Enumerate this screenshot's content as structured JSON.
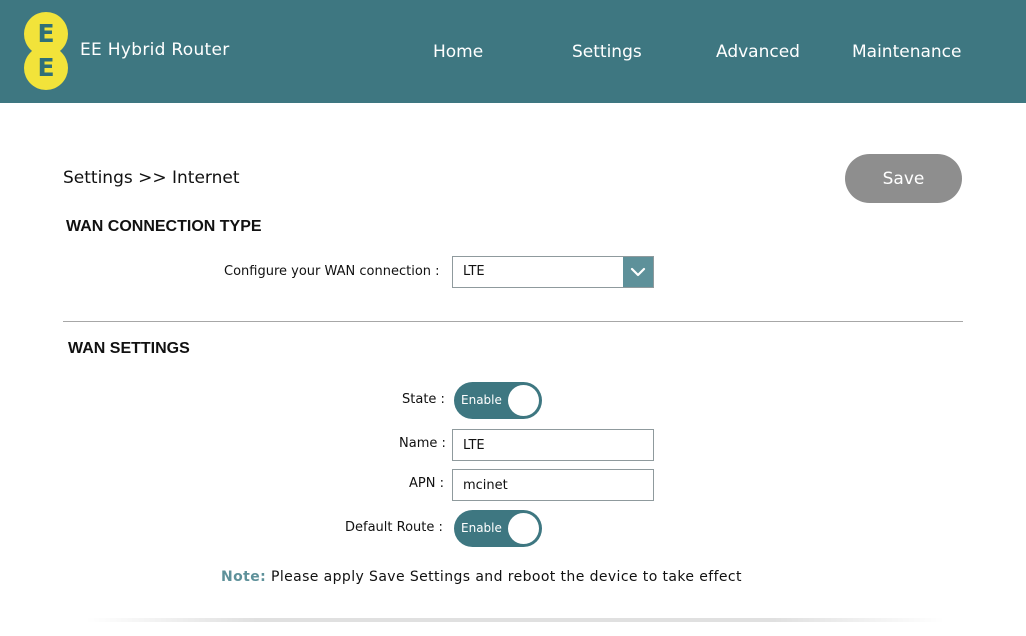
{
  "header": {
    "logo_letter_top": "E",
    "logo_letter_bottom": "E",
    "brand": "EE Hybrid Router",
    "nav": [
      {
        "label": "Home"
      },
      {
        "label": "Settings"
      },
      {
        "label": "Advanced"
      },
      {
        "label": "Maintenance"
      }
    ]
  },
  "breadcrumb": "Settings >> Internet",
  "save_label": "Save",
  "wan_type": {
    "title": "WAN CONNECTION TYPE",
    "configure_label": "Configure your WAN connection :",
    "selected": "LTE"
  },
  "wan_settings": {
    "title": "WAN SETTINGS",
    "state_label": "State :",
    "state_value": "Enable",
    "name_label": "Name :",
    "name_value": "LTE",
    "apn_label": "APN :",
    "apn_value": "mcinet",
    "default_route_label": "Default Route :",
    "default_route_value": "Enable"
  },
  "note": {
    "key": "Note:",
    "text": "Please apply Save Settings and reboot the device to take effect"
  },
  "colors": {
    "header_bg": "#3e7781",
    "logo_yellow": "#f2e33a",
    "accent": "#5e919a",
    "save_button": "#8e8e8e"
  },
  "icons": {
    "select_arrow": "chevron-down-icon"
  }
}
